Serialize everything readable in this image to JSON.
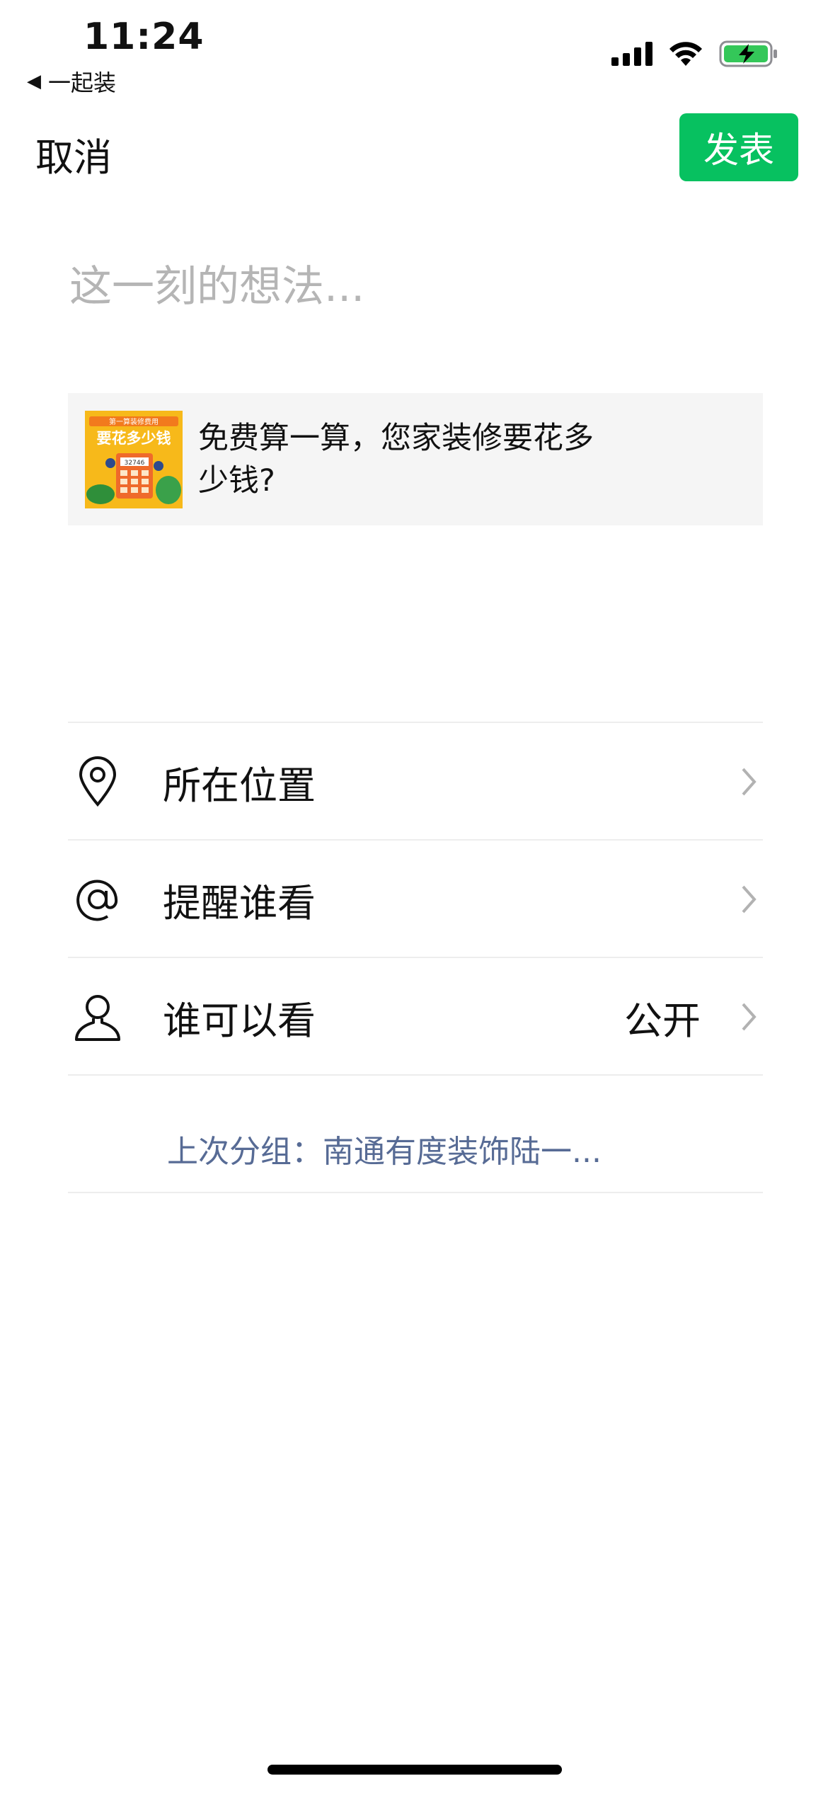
{
  "status_bar": {
    "time": "11:24",
    "back_app": "一起装",
    "back_glyph": "◀"
  },
  "nav": {
    "cancel_label": "取消",
    "publish_label": "发表",
    "publish_color": "#07c160"
  },
  "composer": {
    "placeholder": "这一刻的想法..."
  },
  "link_card": {
    "title": "免费算一算，您家装修要花多少钱?",
    "thumb_banner": "第一算装修费用",
    "thumb_heading": "要花多少钱",
    "thumb_number": "32746"
  },
  "options": [
    {
      "icon": "location-pin-icon",
      "label": "所在位置",
      "value": ""
    },
    {
      "icon": "at-sign-icon",
      "label": "提醒谁看",
      "value": ""
    },
    {
      "icon": "person-icon",
      "label": "谁可以看",
      "value": "公开"
    }
  ],
  "last_group": "上次分组：南通有度装饰陆一..."
}
